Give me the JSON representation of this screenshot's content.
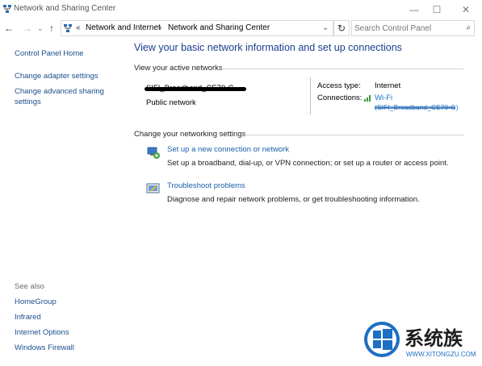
{
  "window": {
    "title": "Network and Sharing Center",
    "minimize": "—",
    "maximize": "☐",
    "close": "✕"
  },
  "addressbar": {
    "back": "←",
    "forward": "→",
    "dropdown": "⌄",
    "up": "↑",
    "overflow": "«",
    "crumbs": [
      "Network and Internet",
      "Network and Sharing Center"
    ],
    "separator": "›",
    "refresh": "↻",
    "search_placeholder": "Search Control Panel",
    "search_icon": "⌕"
  },
  "sidebar": {
    "links": [
      "Control Panel Home",
      "Change adapter settings",
      "Change advanced sharing settings"
    ],
    "see_also_label": "See also",
    "see_also": [
      "HomeGroup",
      "Infrared",
      "Internet Options",
      "Windows Firewall"
    ]
  },
  "main": {
    "heading": "View your basic network information and set up connections",
    "active_networks_label": "View your active networks",
    "network_name": "SIFI_Broadband_CE70-G",
    "network_type": "Public network",
    "access_type_label": "Access type:",
    "access_type_value": "Internet",
    "connections_label": "Connections:",
    "connection_link": "Wi-Fi",
    "connection_ssid": "(SIFI_Broadband_CE70-G)",
    "settings_label": "Change your networking settings",
    "tasks": [
      {
        "icon": "new-connection-icon",
        "title": "Set up a new connection or network",
        "desc": "Set up a broadband, dial-up, or VPN connection; or set up a router or access point."
      },
      {
        "icon": "troubleshoot-icon",
        "title": "Troubleshoot problems",
        "desc": "Diagnose and repair network problems, or get troubleshooting information."
      }
    ]
  },
  "watermark": {
    "brand": "系统族",
    "url": "WWW.XITONGZU.COM",
    "logo_color": "#1d6fc4"
  },
  "colors": {
    "link": "#1a4e8c",
    "heading": "#1a3e8c",
    "wifi_link": "#1a73c4"
  }
}
